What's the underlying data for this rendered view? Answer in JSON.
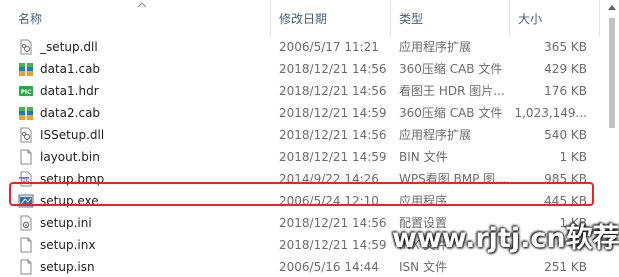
{
  "columns": {
    "name": "名称",
    "date": "修改日期",
    "type": "类型",
    "size": "大小"
  },
  "files": [
    {
      "name": "_setup.dll",
      "date": "2006/5/17 11:21",
      "type": "应用程序扩展",
      "size": "365 KB",
      "icon": "dll-icon"
    },
    {
      "name": "data1.cab",
      "date": "2018/12/21 14:56",
      "type": "360压缩 CAB 文件",
      "size": "429 KB",
      "icon": "archive-icon"
    },
    {
      "name": "data1.hdr",
      "date": "2018/12/21 14:56",
      "type": "看图王 HDR 图片...",
      "size": "176 KB",
      "icon": "image-pic-icon"
    },
    {
      "name": "data2.cab",
      "date": "2018/12/21 14:59",
      "type": "360压缩 CAB 文件",
      "size": "1,023,149...",
      "icon": "archive-icon"
    },
    {
      "name": "ISSetup.dll",
      "date": "2018/12/21 14:56",
      "type": "应用程序扩展",
      "size": "540 KB",
      "icon": "dll-icon"
    },
    {
      "name": "layout.bin",
      "date": "2018/12/21 14:59",
      "type": "BIN 文件",
      "size": "1 KB",
      "icon": "file-icon"
    },
    {
      "name": "setup.bmp",
      "date": "2014/9/22 14:26",
      "type": "WPS看图 BMP 图...",
      "size": "985 KB",
      "icon": "bmp-image-icon"
    },
    {
      "name": "setup.exe",
      "date": "2006/5/24 12:10",
      "type": "应用程序",
      "size": "445 KB",
      "icon": "exe-icon"
    },
    {
      "name": "setup.ini",
      "date": "2018/12/21 14:56",
      "type": "配置设置",
      "size": "1 KB",
      "icon": "ini-icon"
    },
    {
      "name": "setup.inx",
      "date": "2018/12/21 14:59",
      "type": "INX 文件",
      "size": "",
      "icon": "file-icon"
    },
    {
      "name": "setup.isn",
      "date": "2006/5/16 14:44",
      "type": "ISN 文件",
      "size": "251 KB",
      "icon": "file-icon"
    }
  ],
  "watermark": "www.rjtj.cn软荐网",
  "colors": {
    "highlight_border": "#e8232a",
    "header_text": "#4c607a",
    "secondary_text": "#6d6d6d"
  }
}
